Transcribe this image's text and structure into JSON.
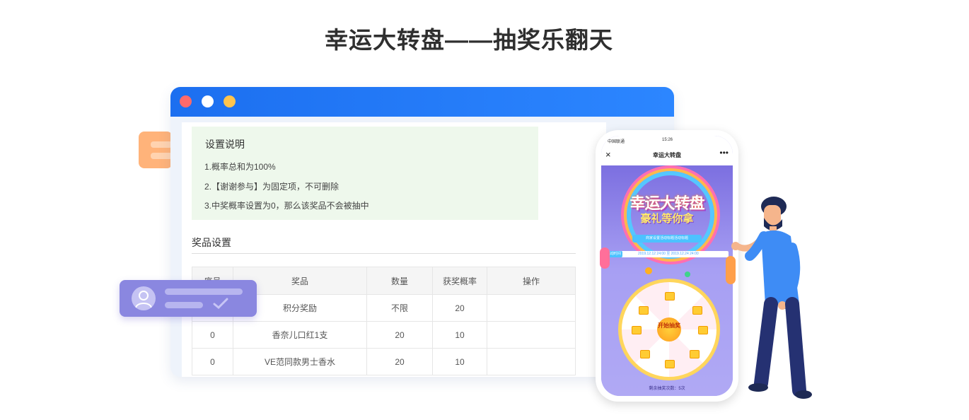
{
  "page": {
    "title": "幸运大转盘——抽奖乐翻天"
  },
  "settings": {
    "title": "设置说明",
    "notes": [
      "1.概率总和为100%",
      "2.【谢谢参与】为固定项，不可删除",
      "3.中奖概率设置为0，那么该奖品不会被抽中"
    ]
  },
  "prizes": {
    "title": "奖品设置",
    "headers": [
      "序号",
      "奖品",
      "数量",
      "获奖概率",
      "操作"
    ],
    "rows": [
      [
        "",
        "积分奖励",
        "不限",
        "20",
        ""
      ],
      [
        "0",
        "香奈儿口红1支",
        "20",
        "10",
        ""
      ],
      [
        "0",
        "VE范同款男士香水",
        "20",
        "10",
        ""
      ]
    ]
  },
  "phone": {
    "carrier": "中国联通",
    "time": "15:26",
    "close": "×",
    "nav_title": "幸运大转盘",
    "more": "•••",
    "banner_main": "幸运大转盘",
    "banner_sub": "豪礼等你拿",
    "merchant_title": "商家设置活动标题活动标题",
    "time_label": "活动时间",
    "time_range": "2019.12.12 24:00 至 2019.12.24 24:00",
    "wheel_button": "开始抽奖",
    "remaining": "剩余抽奖次数：5次"
  },
  "colors": {
    "window_bar": "#1c6ff0",
    "notes_bg": "#eef8ec",
    "orange_card": "#ffb37a",
    "user_card": "#8a87e0"
  }
}
